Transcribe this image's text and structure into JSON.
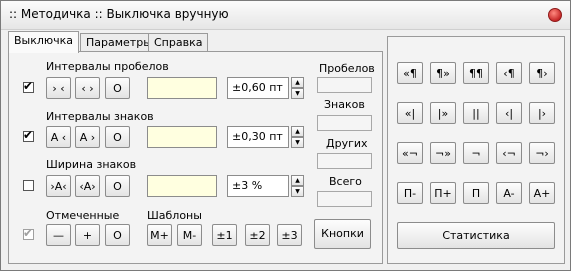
{
  "window": {
    "title": ":: Методичка :: Выключка вручную"
  },
  "tabs": [
    "Выключка",
    "Параметры",
    "Справка"
  ],
  "rows": {
    "spaces": {
      "label": "Интервалы пробелов",
      "buttons": [
        "› ‹",
        "‹ ›",
        "O"
      ],
      "value": "±0,60 пт",
      "checked": true
    },
    "chars": {
      "label": "Интервалы знаков",
      "buttons": [
        "A ‹",
        "A ›",
        "O"
      ],
      "value": "±0,30 пт",
      "checked": true
    },
    "width": {
      "label": "Ширина знаков",
      "buttons": [
        "›A‹",
        "‹A›",
        "O"
      ],
      "value": "±3 %",
      "checked": false
    }
  },
  "marked": {
    "label": "Отмеченные",
    "buttons": [
      "—",
      "+",
      "O"
    ],
    "checked": true
  },
  "templates": {
    "label": "Шаблоны",
    "buttons": [
      "M+",
      "M-",
      "±1",
      "±2",
      "±3"
    ]
  },
  "stats": {
    "spaces": "Пробелов",
    "chars": "Знаков",
    "other": "Других",
    "total": "Всего"
  },
  "buttons_toggle": "Кнопки",
  "right_grid": [
    [
      "«¶",
      "¶»",
      "¶¶",
      "‹¶",
      "¶›"
    ],
    [
      "«|",
      "|»",
      "||",
      "‹|",
      "|›"
    ],
    [
      "«¬",
      "¬»",
      "¬",
      "‹¬",
      "¬›"
    ],
    [
      "П-",
      "П+",
      "П",
      "A-",
      "A+"
    ]
  ],
  "statistics_button": "Статистика"
}
